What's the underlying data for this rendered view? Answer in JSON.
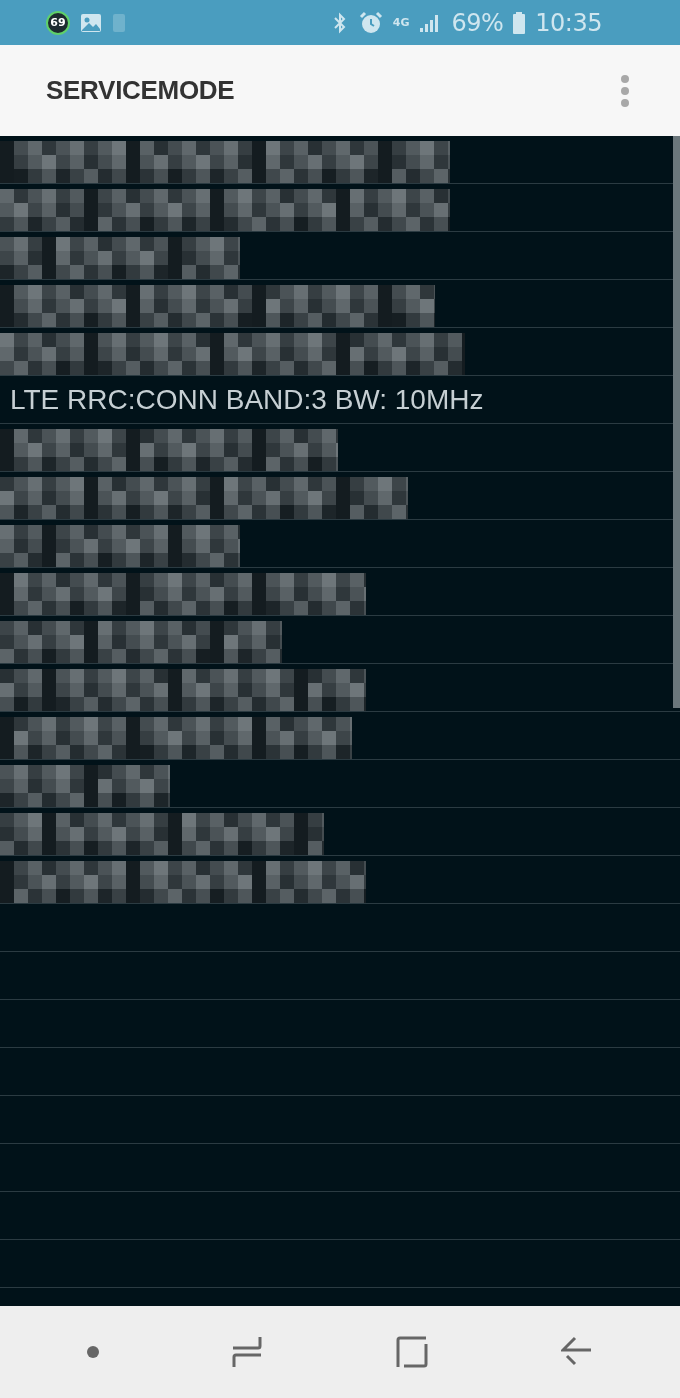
{
  "status_bar": {
    "notification_badge": "69",
    "network": "4G",
    "battery": "69%",
    "time": "10:35"
  },
  "app_bar": {
    "title": "SERVICEMODE"
  },
  "rows": [
    {
      "kind": "redacted"
    },
    {
      "kind": "redacted"
    },
    {
      "kind": "redacted"
    },
    {
      "kind": "redacted"
    },
    {
      "kind": "redacted"
    },
    {
      "kind": "text",
      "text": "LTE RRC:CONN BAND:3 BW: 10MHz"
    },
    {
      "kind": "redacted"
    },
    {
      "kind": "redacted"
    },
    {
      "kind": "redacted"
    },
    {
      "kind": "redacted"
    },
    {
      "kind": "redacted"
    },
    {
      "kind": "redacted"
    },
    {
      "kind": "redacted"
    },
    {
      "kind": "redacted"
    },
    {
      "kind": "redacted"
    },
    {
      "kind": "redacted"
    }
  ]
}
